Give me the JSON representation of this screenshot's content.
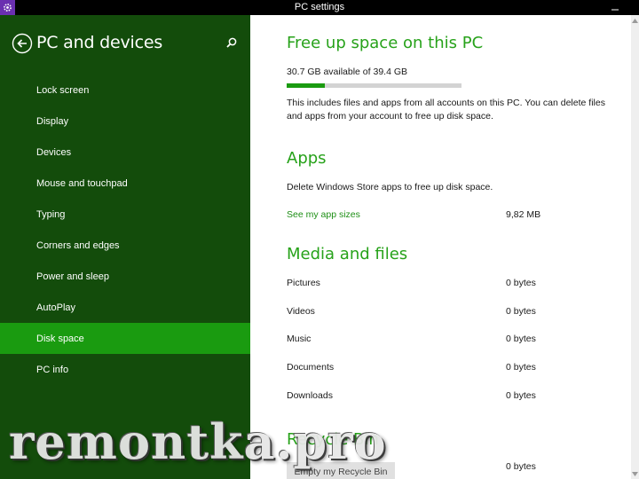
{
  "window": {
    "title": "PC settings"
  },
  "sidebar": {
    "header": "PC and devices",
    "items": [
      {
        "label": "Lock screen"
      },
      {
        "label": "Display"
      },
      {
        "label": "Devices"
      },
      {
        "label": "Mouse and touchpad"
      },
      {
        "label": "Typing"
      },
      {
        "label": "Corners and edges"
      },
      {
        "label": "Power and sleep"
      },
      {
        "label": "AutoPlay"
      },
      {
        "label": "Disk space",
        "selected": true
      },
      {
        "label": "PC info"
      }
    ]
  },
  "main": {
    "free_space": {
      "title": "Free up space on this PC",
      "status": "30.7 GB available of 39.4 GB",
      "used_fraction": 0.22,
      "description": "This includes files and apps from all accounts on this PC. You can delete files and apps from your account to free up disk space."
    },
    "apps": {
      "title": "Apps",
      "description": "Delete Windows Store apps to free up disk space.",
      "link": "See my app sizes",
      "size": "9,82 MB"
    },
    "media": {
      "title": "Media and files",
      "rows": [
        {
          "label": "Pictures",
          "value": "0 bytes"
        },
        {
          "label": "Videos",
          "value": "0 bytes"
        },
        {
          "label": "Music",
          "value": "0 bytes"
        },
        {
          "label": "Documents",
          "value": "0 bytes"
        },
        {
          "label": "Downloads",
          "value": "0 bytes"
        }
      ]
    },
    "recycle": {
      "title": "Recycle Bin",
      "value": "0 bytes",
      "button": "Empty my Recycle Bin"
    }
  },
  "watermark": "remontka.pro",
  "colors": {
    "sidebar": "#134c0b",
    "selected": "#1a9b10",
    "accent_text": "#27a21a",
    "app_icon": "#6a2fb0"
  },
  "icons": {
    "app": "gear-icon",
    "back": "back-arrow-icon",
    "search": "search-icon"
  }
}
